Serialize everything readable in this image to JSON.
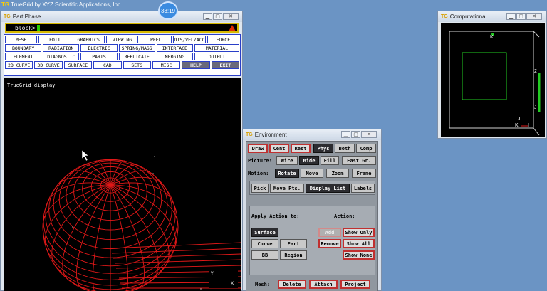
{
  "app": {
    "title": "TrueGrid by XYZ Scientific Applications, Inc.",
    "logo": "TG",
    "clock": "33:19"
  },
  "part_phase": {
    "title": "Part Phase",
    "prompt": "block>",
    "commands": [
      [
        "MESH",
        "EDIT",
        "GRAPHICS",
        "VIEWING",
        "PEEL",
        "DIS/VEL/ACC",
        "FORCE"
      ],
      [
        "BOUNDARY",
        "RADIATION",
        "ELECTRIC",
        "SPRING/MASS",
        "INTERFACE",
        "MATERIAL"
      ],
      [
        "ELEMENT",
        "DIAGNOSTIC",
        "PARTS",
        "REPLICATE",
        "MERGING",
        "OUTPUT"
      ],
      [
        "2D CURVE",
        "3D CURVE",
        "SURFACE",
        "CAD",
        "SETS",
        "MISC",
        "HELP",
        "EXIT"
      ]
    ],
    "display_label": "TrueGrid display",
    "axes": {
      "y": "Y",
      "x": "X"
    }
  },
  "computational": {
    "title": "Computational",
    "labels": {
      "k_top": "K",
      "i_label": "I",
      "num_2_bottom": "2",
      "num_2_right": "2",
      "j_label": "J",
      "j_small": "J",
      "k_small": "K",
      "i_small": "I"
    }
  },
  "environment": {
    "title": "Environment",
    "view_buttons": [
      "Draw",
      "Cent",
      "Rest",
      "Phys",
      "Both",
      "Comp"
    ],
    "picture_label": "Picture:",
    "picture_buttons": [
      "Wire",
      "Hide",
      "Fill",
      "Fast Gr."
    ],
    "motion_label": "Motion:",
    "motion_buttons": [
      "Rotate",
      "Move",
      "Zoom",
      "Frame"
    ],
    "tool_buttons": [
      "Pick",
      "Move Pts.",
      "Display List",
      "Labels"
    ],
    "apply_label": "Apply Action to:",
    "action_label": "Action:",
    "apply_buttons": [
      "Surface",
      "Curve",
      "Part",
      "BB",
      "Region"
    ],
    "action_buttons": [
      "Add",
      "Show Only",
      "Remove",
      "Show All",
      "Show None"
    ],
    "mesh_label": "Mesh:",
    "mesh_buttons": [
      "Delete",
      "Attach",
      "Project"
    ]
  },
  "colors": {
    "wire": "#e01818",
    "grid_green": "#22cc22",
    "prompt_border": "#d6b800"
  }
}
